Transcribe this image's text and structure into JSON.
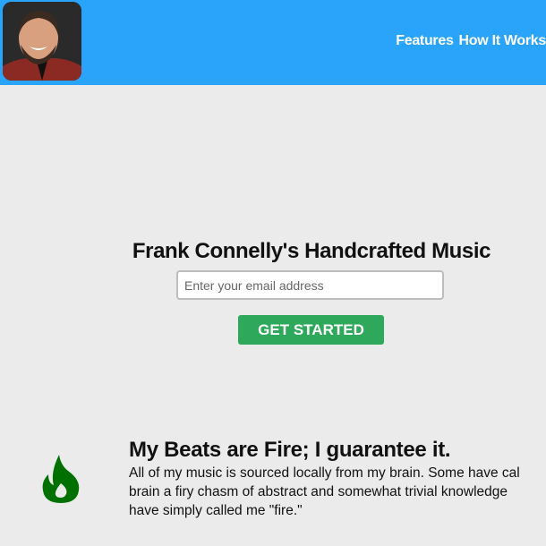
{
  "header": {
    "nav": [
      {
        "label": "Features"
      },
      {
        "label": "How It Works"
      }
    ]
  },
  "hero": {
    "title": "Frank Connelly's Handcrafted Music",
    "email_placeholder": "Enter your email address",
    "cta_label": "GET STARTED"
  },
  "features": [
    {
      "icon": "fire-icon",
      "title": "My Beats are Fire; I guarantee it.",
      "lines": [
        "All of my music is sourced locally from my brain. Some have cal",
        "brain a firy chasm of abstract and somewhat trivial knowledge",
        "have simply called me \"fire.\""
      ]
    }
  ],
  "colors": {
    "header": "#2aa4fb",
    "cta": "#2ea85a",
    "fire": "#007000"
  }
}
